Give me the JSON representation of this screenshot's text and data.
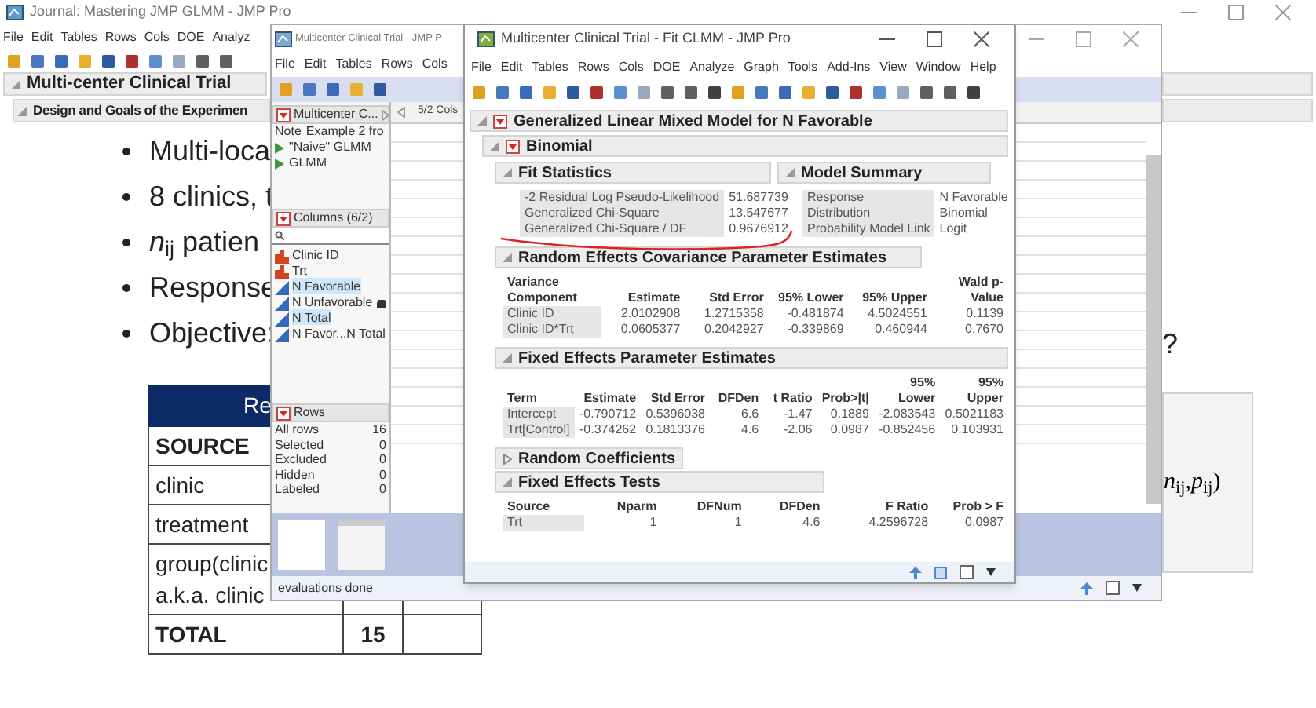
{
  "journal": {
    "title": "Journal: Mastering JMP GLMM - JMP Pro",
    "menu": [
      "File",
      "Edit",
      "Tables",
      "Rows",
      "Cols",
      "DOE",
      "Analyz"
    ],
    "outline": {
      "title": "Multi-center Clinical Trial",
      "expanded": true
    },
    "section": {
      "title": "Design and Goals of the Experimen",
      "expanded": true
    },
    "bullets": [
      "Multi-loca",
      "8 clinics, t",
      "*n*$_{ij}$ patien",
      "Response",
      "Objective:"
    ],
    "question_mark": "?",
    "table": {
      "header": "Re",
      "rows": [
        {
          "source": "SOURCE",
          "value": "",
          "bold": true
        },
        {
          "source": "clinic",
          "value": "",
          "bold": false
        },
        {
          "source": "treatment",
          "value": "",
          "bold": false
        },
        {
          "source": "group(clinic\na.k.a. clinic",
          "value": "",
          "bold": false
        },
        {
          "source": "TOTAL",
          "value": "15",
          "bold": true
        }
      ]
    },
    "formula": "*n*$_{ij}$,*p*$_{ij}$)"
  },
  "data_table_window": {
    "title": "Multicenter Clinical Trial - JMP P",
    "menu": [
      "File",
      "Edit",
      "Tables",
      "Rows",
      "Cols"
    ],
    "table_panel": {
      "title": "Multicenter C...",
      "items": [
        {
          "kind": "note",
          "label": "Note",
          "text": "Example 2 fro"
        },
        {
          "kind": "script",
          "text": "\"Naive\" GLMM"
        },
        {
          "kind": "script",
          "text": "GLMM"
        }
      ]
    },
    "grid_header": "5/2 Cols",
    "columns_panel": {
      "title": "Columns (6/2)",
      "items": [
        {
          "name": "Clinic ID",
          "kind": "nominal",
          "selected": false,
          "flag": false
        },
        {
          "name": "Trt",
          "kind": "nominal",
          "selected": false,
          "flag": false
        },
        {
          "name": "N Favorable",
          "kind": "continuous",
          "selected": true,
          "flag": false
        },
        {
          "name": "N Unfavorable",
          "kind": "continuous",
          "selected": false,
          "flag": true
        },
        {
          "name": "N Total",
          "kind": "continuous",
          "selected": true,
          "flag": false
        },
        {
          "name": "N Favor...N Total",
          "kind": "continuous",
          "selected": false,
          "flag": false
        }
      ]
    },
    "rows_panel": {
      "title": "Rows",
      "rows": [
        {
          "label": "All rows",
          "value": "16"
        },
        {
          "label": "Selected",
          "value": "0"
        },
        {
          "label": "Excluded",
          "value": "0"
        },
        {
          "label": "Hidden",
          "value": "0"
        },
        {
          "label": "Labeled",
          "value": "0"
        }
      ]
    },
    "status": "evaluations done"
  },
  "fit_window": {
    "title": "Multicenter Clinical Trial - Fit CLMM - JMP Pro",
    "menu": [
      "File",
      "Edit",
      "Tables",
      "Rows",
      "Cols",
      "DOE",
      "Analyze",
      "Graph",
      "Tools",
      "Add-Ins",
      "View",
      "Window",
      "Help"
    ],
    "report": {
      "title": "Generalized Linear Mixed Model for N Favorable",
      "expanded": true
    },
    "binomial": {
      "title": "Binomial",
      "expanded": true
    },
    "fit_statistics": {
      "title": "Fit Statistics",
      "expanded": true,
      "rows": [
        {
          "label": "-2 Residual Log Pseudo-Likelihood",
          "value": "51.687739"
        },
        {
          "label": "Generalized Chi-Square",
          "value": "13.547677"
        },
        {
          "label": "Generalized Chi-Square / DF",
          "value": "0.9676912"
        }
      ]
    },
    "model_summary": {
      "title": "Model Summary",
      "expanded": true,
      "rows": [
        {
          "label": "Response",
          "value": "N Favorable"
        },
        {
          "label": "Distribution",
          "value": "Binomial"
        },
        {
          "label": "Probability Model Link",
          "value": "Logit"
        }
      ]
    },
    "random_effects": {
      "title": "Random Effects Covariance Parameter Estimates",
      "expanded": true,
      "columns": [
        "Variance\nComponent",
        "Estimate",
        "Std Error",
        "95% Lower",
        "95% Upper",
        "Wald p-\nValue"
      ],
      "rows": [
        [
          "Clinic ID",
          "2.0102908",
          "1.2715358",
          "-0.481874",
          "4.5024551",
          "0.1139"
        ],
        [
          "Clinic ID*Trt",
          "0.0605377",
          "0.2042927",
          "-0.339869",
          "0.460944",
          "0.7670"
        ]
      ]
    },
    "fixed_effects": {
      "title": "Fixed Effects Parameter Estimates",
      "expanded": true,
      "columns": [
        "Term",
        "Estimate",
        "Std Error",
        "DFDen",
        "t Ratio",
        "Prob>|t|",
        "95% Lower",
        "95% Upper"
      ],
      "rows": [
        [
          "Intercept",
          "-0.790712",
          "0.5396038",
          "6.6",
          "-1.47",
          "0.1889",
          "-2.083543",
          "0.5021183"
        ],
        [
          "Trt[Control]",
          "-0.374262",
          "0.1813376",
          "4.6",
          "-2.06",
          "0.0987",
          "-0.852456",
          "0.103931"
        ]
      ]
    },
    "random_coefficients": {
      "title": "Random Coefficients",
      "expanded": false
    },
    "fixed_tests": {
      "title": "Fixed Effects Tests",
      "expanded": true,
      "columns": [
        "Source",
        "Nparm",
        "DFNum",
        "DFDen",
        "F Ratio",
        "Prob > F"
      ],
      "rows": [
        [
          "Trt",
          "1",
          "1",
          "4.6",
          "4.2596728",
          "0.0987"
        ]
      ]
    }
  }
}
